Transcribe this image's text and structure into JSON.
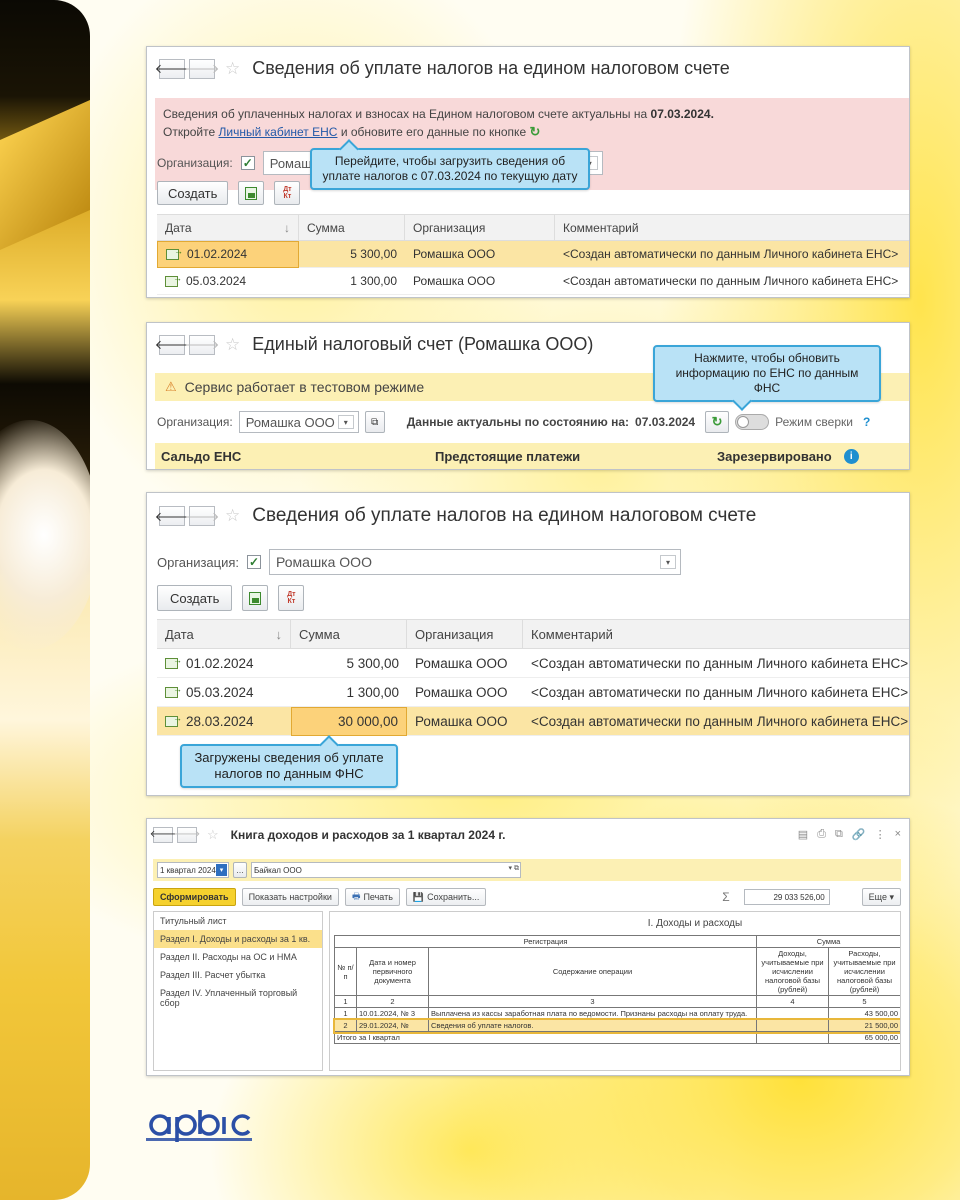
{
  "colors": {
    "alert_bg": "#f8d9d9",
    "warning_bg": "#fcf0b4",
    "callout_bg": "#b9e2f6",
    "callout_border": "#3aa5d8",
    "selected_row": "#fbe5a4",
    "form_button": "#f5d12e",
    "brand_logo": "#2b4fa6"
  },
  "win1": {
    "title": "Сведения об уплате налогов на едином налоговом счете",
    "alert_line1_prefix": "Сведения об уплаченных налогах и взносах на Едином налоговом счете актуальны на",
    "alert_date": "07.03.2024.",
    "alert_line2_prefix": "Откройте",
    "alert_link": "Личный кабинет ЕНС",
    "alert_line2_suffix": "и обновите его данные по кнопке",
    "org_label": "Организация:",
    "org_value": "Ромашка ООО",
    "create_label": "Создать",
    "dtkt_top": "Дт",
    "dtkt_bottom": "Кт",
    "callout": "Перейдите, чтобы загрузить сведения об уплате налогов с 07.03.2024 по текущую дату",
    "columns": [
      "Дата",
      "Сумма",
      "Организация",
      "Комментарий"
    ],
    "sort_glyph": "↓",
    "rows": [
      {
        "date": "01.02.2024",
        "sum": "5 300,00",
        "org": "Ромашка ООО",
        "comment": "<Создан автоматически по данным Личного кабинета ЕНС>"
      },
      {
        "date": "05.03.2024",
        "sum": "1 300,00",
        "org": "Ромашка ООО",
        "comment": "<Создан автоматически по данным Личного кабинета ЕНС>"
      }
    ]
  },
  "win2": {
    "title": "Единый налоговый счет (Ромашка ООО)",
    "warning": "Сервис работает в тестовом режиме",
    "org_label": "Организация:",
    "org_value": "Ромашка ООО",
    "actual_label": "Данные актуальны по состоянию на:",
    "actual_date": "07.03.2024",
    "reconcile_label": "Режим сверки",
    "help": "?",
    "callout": "Нажмите, чтобы обновить информацию по ЕНС по данным ФНС",
    "saldo": "Сальдо ЕНС",
    "upcoming": "Предстоящие платежи",
    "reserved": "Зарезервировано"
  },
  "win3": {
    "title": "Сведения об уплате налогов на едином налоговом счете",
    "org_label": "Организация:",
    "org_value": "Ромашка ООО",
    "create_label": "Создать",
    "columns": [
      "Дата",
      "Сумма",
      "Организация",
      "Комментарий"
    ],
    "rows": [
      {
        "date": "01.02.2024",
        "sum": "5 300,00",
        "org": "Ромашка ООО",
        "comment": "<Создан автоматически по данным Личного кабинета ЕНС>"
      },
      {
        "date": "05.03.2024",
        "sum": "1 300,00",
        "org": "Ромашка ООО",
        "comment": "<Создан автоматически по данным Личного кабинета ЕНС>"
      },
      {
        "date": "28.03.2024",
        "sum": "30 000,00",
        "org": "Ромашка ООО",
        "comment": "<Создан автоматически по данным Личного кабинета ЕНС>"
      }
    ],
    "callout": "Загружены сведения об уплате налогов по данным ФНС"
  },
  "win4": {
    "title": "Книга доходов и расходов за 1 квартал 2024 г.",
    "period": "1 квартал 2024 г.",
    "org": "Байкал ООО",
    "form_btn": "Сформировать",
    "settings_btn": "Показать настройки",
    "print_btn": "Печать",
    "save_btn": "Сохранить...",
    "sigma": "Σ",
    "total": "29 033 526,00",
    "more_btn": "Еще",
    "sections": [
      "Титульный лист",
      "Раздел I. Доходы и расходы за 1 кв.",
      "Раздел II. Расходы на ОС и НМА",
      "Раздел III. Расчет убытка",
      "Раздел IV. Уплаченный торговый сбор"
    ],
    "section_heading": "I. Доходы и расходы",
    "table": {
      "h_registration": "Регистрация",
      "h_sum": "Сумма",
      "h_num": "№ п/п",
      "h_date_doc": "Дата и номер первичного документа",
      "h_content": "Содержание операции",
      "h_income": "Доходы, учитываемые при исчислении налоговой базы (рублей)",
      "h_expense": "Расходы, учитываемые при исчислении налоговой базы (рублей)",
      "nums": [
        "1",
        "2",
        "3",
        "4",
        "5"
      ],
      "rows": [
        {
          "n": "1",
          "doc": "10.01.2024, № 3",
          "content": "Выплачена из кассы заработная плата по ведомости. Признаны расходы на оплату труда.",
          "income": "",
          "expense": "43 500,00"
        },
        {
          "n": "2",
          "doc": "29.01.2024, №",
          "content": "Сведения об уплате налогов.",
          "income": "",
          "expense": "21 500,00"
        }
      ],
      "total_label": "Итого за I квартал",
      "total_expense": "65 000,00"
    }
  },
  "logo_text": "арбис"
}
